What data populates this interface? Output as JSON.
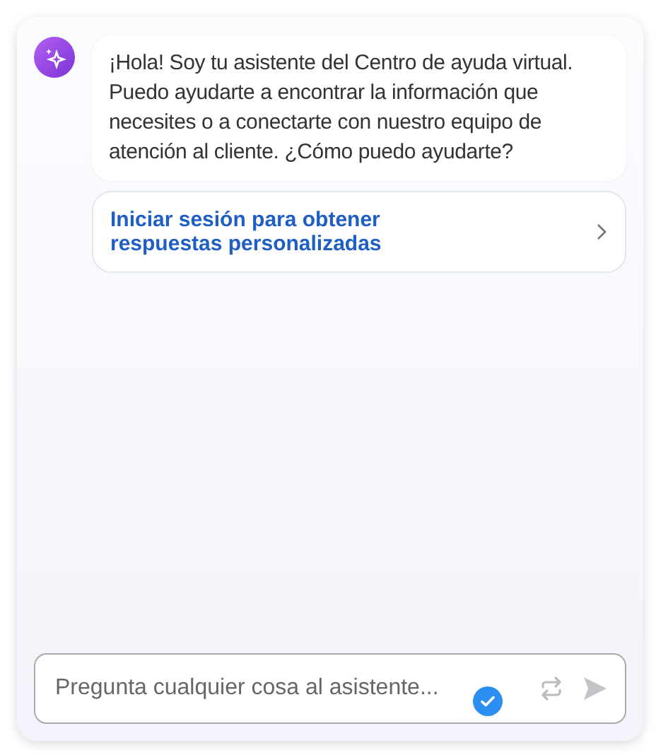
{
  "message": {
    "text": "¡Hola! Soy tu asistente del Centro de ayuda virtual. Puedo ayudarte a encontrar la información que necesites o a conectarte con nuestro equipo de atención al cliente. ¿Cómo puedo ayudarte?"
  },
  "login_link": {
    "text": "Iniciar sesión para obtener respuestas personalizadas"
  },
  "input": {
    "placeholder": "Pregunta cualquier cosa al asistente...",
    "send_disabled": true
  }
}
